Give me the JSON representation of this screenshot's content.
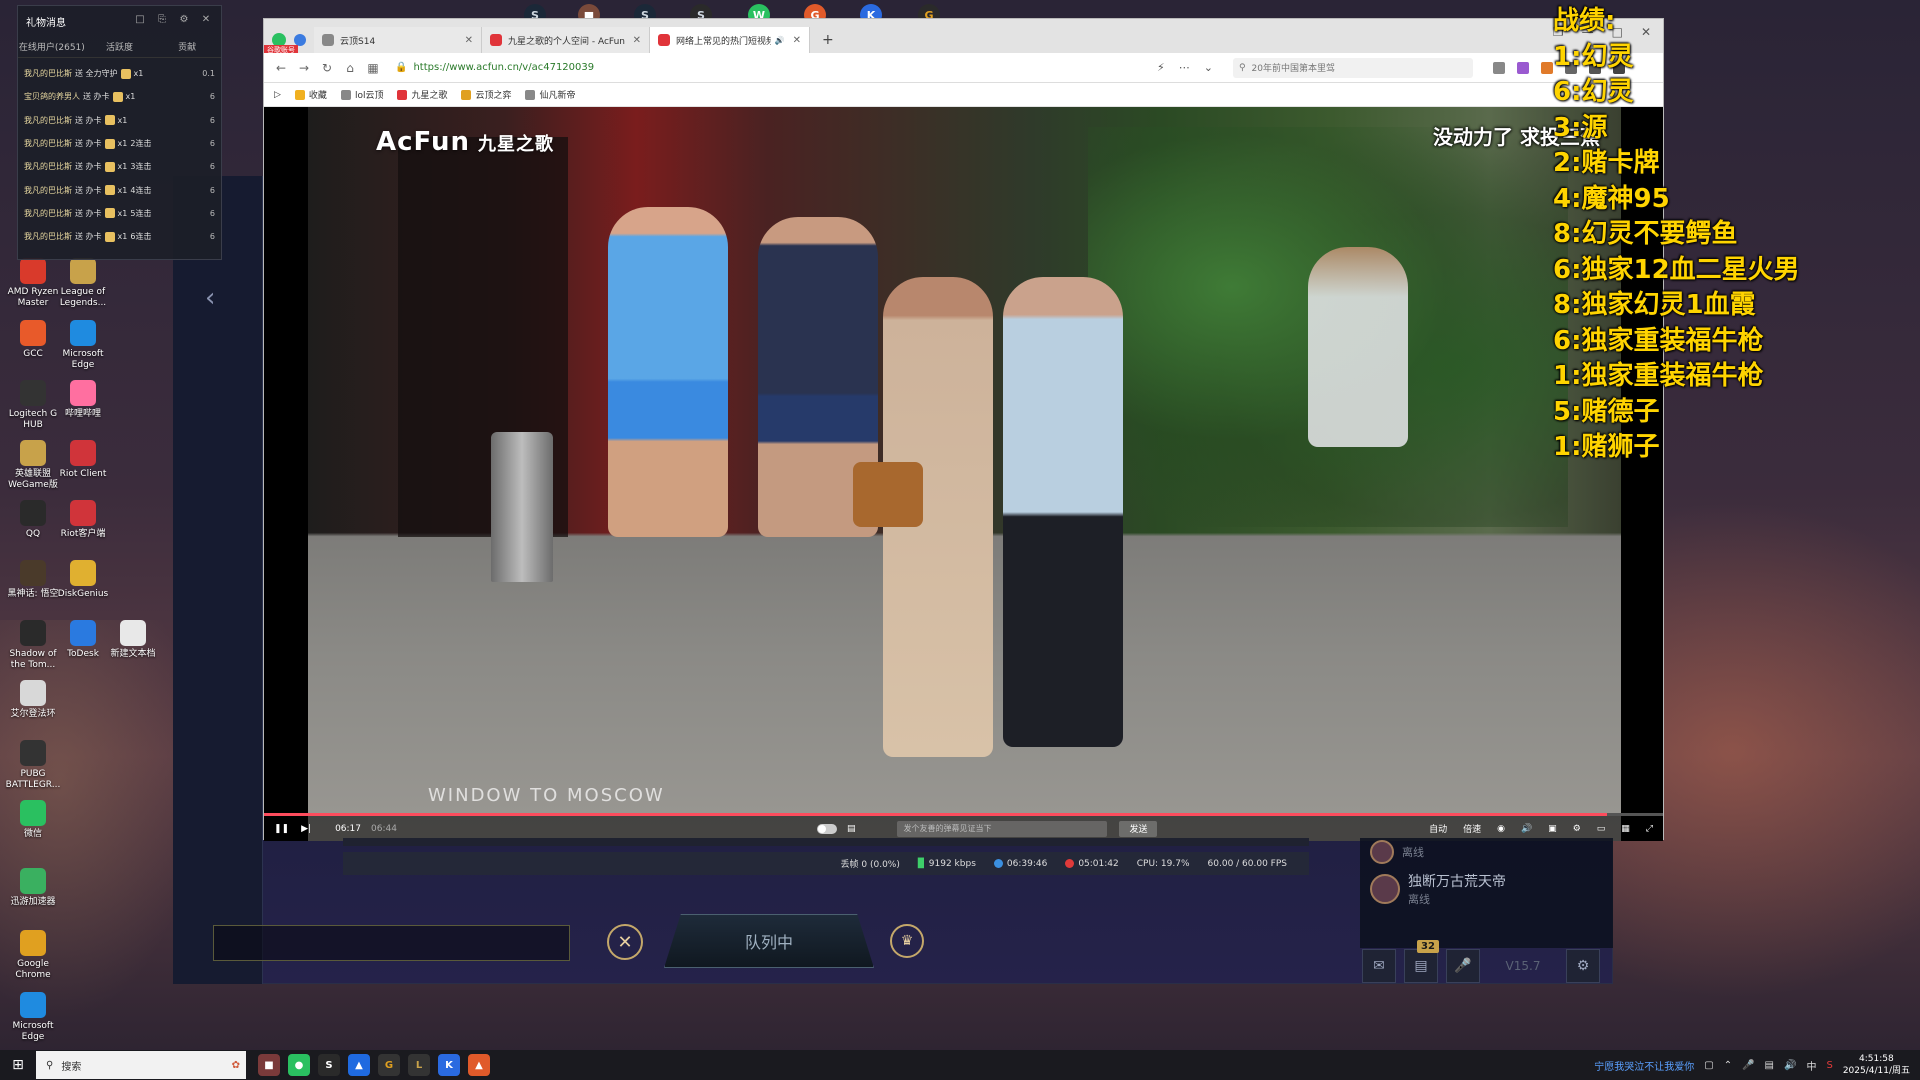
{
  "desktop": {
    "icons": [
      {
        "label": "AMD Ryzen Master",
        "icon": "amd-ryzen-icon",
        "color": "#d93a2b"
      },
      {
        "label": "League of Legends...",
        "icon": "league-icon",
        "color": "#c8a24a"
      },
      {
        "label": "GCC",
        "icon": "gcc-icon",
        "color": "#e85a2a"
      },
      {
        "label": "Microsoft Edge",
        "icon": "edge-icon",
        "color": "#1f8be0"
      },
      {
        "label": "Logitech G HUB",
        "icon": "logitech-icon",
        "color": "#333333"
      },
      {
        "label": "哔哩哔哩",
        "icon": "bilibili-icon",
        "color": "#ff6fa0"
      },
      {
        "label": "英雄联盟WeGame版",
        "icon": "lol-wegame-icon",
        "color": "#c8a24a"
      },
      {
        "label": "Riot Client",
        "icon": "riot-icon",
        "color": "#d0343a"
      },
      {
        "label": "QQ",
        "icon": "qq-icon",
        "color": "#2a2a2a"
      },
      {
        "label": "Riot客户端",
        "icon": "riot-icon",
        "color": "#d0343a"
      },
      {
        "label": "黑神话: 悟空",
        "icon": "wukong-icon",
        "color": "#4a3a2a"
      },
      {
        "label": "DiskGenius",
        "icon": "diskgenius-icon",
        "color": "#e0b030"
      },
      {
        "label": "Shadow of the Tom...",
        "icon": "tomb-raider-icon",
        "color": "#2a2a2a"
      },
      {
        "label": "ToDesk",
        "icon": "todesk-icon",
        "color": "#2a7ae0"
      },
      {
        "label": "新建文本档",
        "icon": "text-file-icon",
        "color": "#e8e8e8"
      },
      {
        "label": "艾尔登法环",
        "icon": "elden-ring-icon",
        "color": "#d8d8d8"
      },
      {
        "label": "PUBG BATTLEGR...",
        "icon": "pubg-icon",
        "color": "#333333"
      },
      {
        "label": "微信",
        "icon": "wechat-icon",
        "color": "#2ac060"
      },
      {
        "label": "迅游加速器",
        "icon": "xunyou-icon",
        "color": "#3ab060"
      },
      {
        "label": "Google Chrome",
        "icon": "chrome-icon",
        "color": "#e0a020"
      },
      {
        "label": "Microsoft Edge",
        "icon": "edge-icon",
        "color": "#1f8be0"
      }
    ]
  },
  "gift_panel": {
    "title": "礼物消息",
    "tabs": [
      "在线用户(2651)",
      "活跃度",
      "贡献"
    ],
    "rows": [
      {
        "user": "我凡的巴比斯",
        "action": "送 全力守护",
        "count": "x1",
        "combo": "",
        "right": "0.1"
      },
      {
        "user": "宝贝鸽的养男人",
        "action": "送 办卡",
        "count": "x1",
        "combo": "",
        "right": "6"
      },
      {
        "user": "我凡的巴比斯",
        "action": "送 办卡",
        "count": "x1",
        "combo": "",
        "right": "6"
      },
      {
        "user": "我凡的巴比斯",
        "action": "送 办卡",
        "count": "x1",
        "combo": "2连击",
        "right": "6"
      },
      {
        "user": "我凡的巴比斯",
        "action": "送 办卡",
        "count": "x1",
        "combo": "3连击",
        "right": "6"
      },
      {
        "user": "我凡的巴比斯",
        "action": "送 办卡",
        "count": "x1",
        "combo": "4连击",
        "right": "6"
      },
      {
        "user": "我凡的巴比斯",
        "action": "送 办卡",
        "count": "x1",
        "combo": "5连击",
        "right": "6"
      },
      {
        "user": "我凡的巴比斯",
        "action": "送 办卡",
        "count": "x1",
        "combo": "6连击",
        "right": "6"
      }
    ]
  },
  "browser": {
    "tabs": [
      {
        "label": "云顶S14",
        "active": false,
        "color": "#888888"
      },
      {
        "label": "九星之歌的个人空间 - AcFun",
        "active": false,
        "color": "#e0343a"
      },
      {
        "label": "网络上常见的热门短视频",
        "active": true,
        "color": "#e0343a"
      }
    ],
    "badge": "谷歌账号",
    "url": "https://www.acfun.cn/v/ac47120039",
    "search_placeholder": "20年前中国第本里驾",
    "bookmarks": [
      "收藏",
      "lol云顶",
      "九星之歌",
      "云顶之弈",
      "仙凡新帝"
    ]
  },
  "video": {
    "brand": "AcFun",
    "brand_sub": "九星之歌",
    "overlay_message": "没动力了 求投三蕉",
    "caption": "WINDOW TO MOSCOW",
    "time_current": "06:17",
    "time_total": "06:44",
    "progress_fraction": 0.96,
    "danmaku_placeholder": "发个友善的弹幕见证当下",
    "send_label": "发送",
    "quality_label": "自动",
    "speed_label": "倍速"
  },
  "obs_status": {
    "dropped": "丢帧 0 (0.0%)",
    "bitrate": "9192 kbps",
    "stream_time": "06:39:46",
    "record_time": "05:01:42",
    "cpu": "CPU: 19.7%",
    "fps": "60.00 / 60.00 FPS"
  },
  "game_lobby": {
    "queue_label": "队列中",
    "friends": [
      {
        "name": "",
        "status": "离线"
      },
      {
        "name": "独断万古荒天帝",
        "status": "离线"
      }
    ],
    "notification_count": "32",
    "version": "V15.7"
  },
  "record_overlay": {
    "heading": "战绩:",
    "lines": [
      "1:幻灵",
      "6:幻灵",
      "3:源",
      "2:赌卡牌",
      "4:魔神95",
      "8:幻灵不要鳄鱼",
      "6:独家12血二星火男",
      "8:独家幻灵1血霞",
      "6:独家重装福牛枪",
      "1:独家重装福牛枪",
      "5:赌德子",
      "1:赌狮子"
    ]
  },
  "taskbar": {
    "search_label": "搜索",
    "marquee": "宁愿我哭泣不让我爱你",
    "input_method": "中",
    "time": "4:51:58",
    "date": "2025/4/11/周五"
  }
}
